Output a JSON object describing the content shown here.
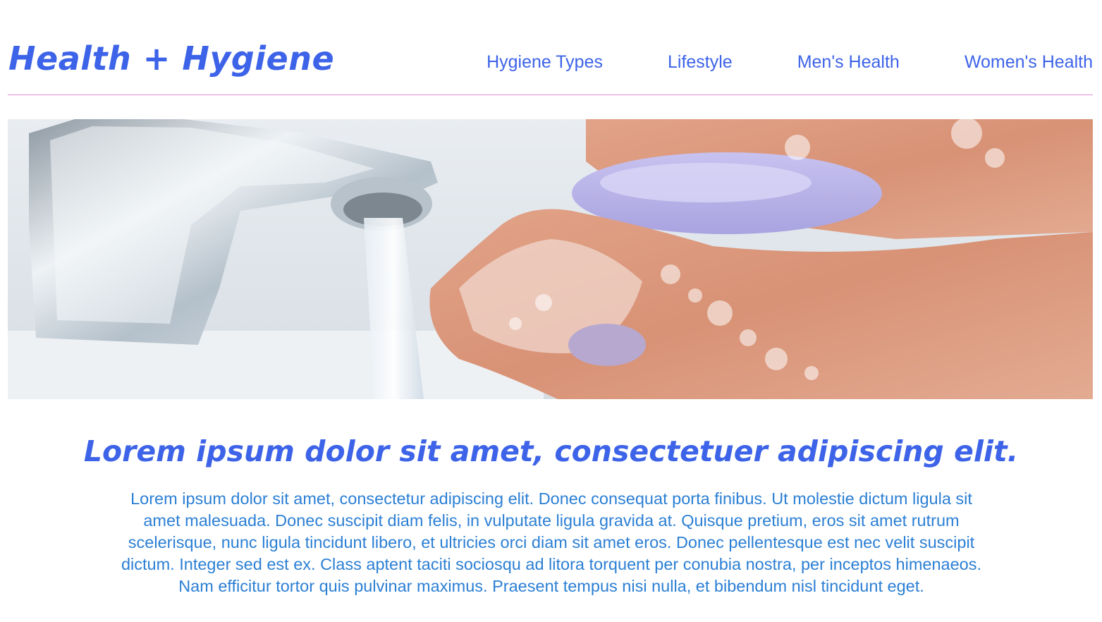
{
  "header": {
    "brand": "Health + Hygiene",
    "nav": [
      {
        "label": "Hygiene Types"
      },
      {
        "label": "Lifestyle"
      },
      {
        "label": "Men's Health"
      },
      {
        "label": "Women's Health"
      }
    ]
  },
  "hero": {
    "image_icon": "hand-washing-photo"
  },
  "article": {
    "headline": "Lorem ipsum dolor sit amet, consectetuer adipiscing elit.",
    "body": "Lorem ipsum dolor sit amet, consectetur adipiscing elit. Donec consequat porta finibus. Ut molestie dictum ligula sit amet malesuada. Donec suscipit diam felis, in vulputate ligula gravida at. Quisque pretium, eros sit amet rutrum scelerisque, nunc ligula tincidunt libero, et ultricies orci diam sit amet eros. Donec pellentesque est nec velit suscipit dictum. Integer sed est ex. Class aptent taciti sociosqu ad litora torquent per conubia nostra, per inceptos himenaeos. Nam efficitur tortor quis pulvinar maximus. Praesent tempus nisi nulla, et bibendum nisl tincidunt eget."
  },
  "colors": {
    "accent": "#3d63e8",
    "body_text": "#2b7fd4",
    "divider": "#e58bd8"
  }
}
